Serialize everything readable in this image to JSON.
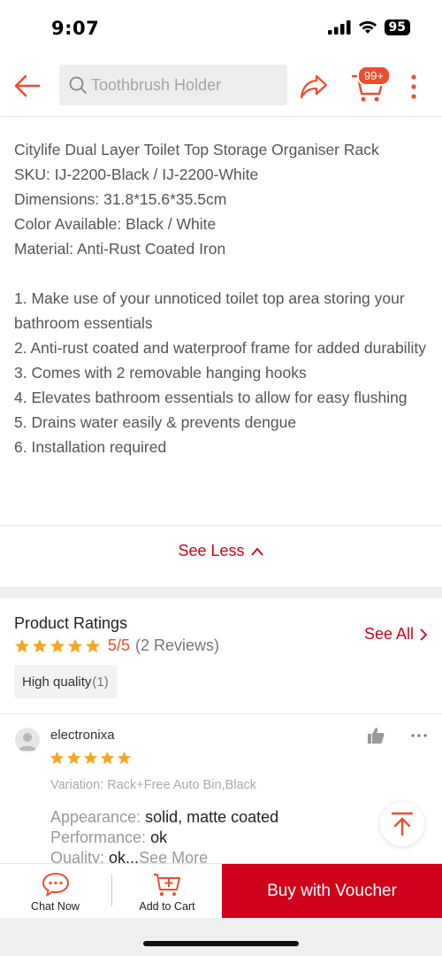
{
  "status_bar": {
    "time": "9:07",
    "battery": "95"
  },
  "top_nav": {
    "search_placeholder": "Toothbrush Holder",
    "cart_badge": "99+"
  },
  "description": {
    "lines": [
      "Citylife Dual Layer Toilet Top Storage Organiser Rack",
      "SKU: IJ-2200-Black / IJ-2200-White",
      "Dimensions: 31.8*15.6*35.5cm",
      "Color Available: Black / White",
      "Material: Anti-Rust Coated Iron"
    ],
    "points": [
      "1. Make use of your unnoticed toilet top area storing your bathroom essentials",
      "2. Anti-rust coated and waterproof frame for added durability",
      "3. Comes with 2 removable hanging hooks",
      "4. Elevates bathroom essentials to allow for easy flushing",
      "5. Drains water easily & prevents dengue",
      "6. Installation required"
    ],
    "see_less": "See Less"
  },
  "ratings": {
    "title": "Product Ratings",
    "score": "5/5",
    "count": "(2 Reviews)",
    "see_all": "See All",
    "tag_label": "High quality",
    "tag_count": "(1)"
  },
  "review": {
    "reviewer": "electronixa",
    "variation": "Variation: Rack+Free Auto Bin,Black",
    "appearance_key": "Appearance:",
    "appearance_val": "solid, matte coated",
    "performance_key": "Performance:",
    "performance_val": "ok",
    "quality_key": "Quality:",
    "quality_val": "ok...",
    "see_more": "See More"
  },
  "bottom_bar": {
    "chat_now": "Chat Now",
    "add_to_cart": "Add to Cart",
    "buy_with_voucher": "Buy with Voucher"
  },
  "colors": {
    "accent": "#ee4d2d",
    "cta_red": "#d0011b",
    "star": "#f5a623"
  }
}
